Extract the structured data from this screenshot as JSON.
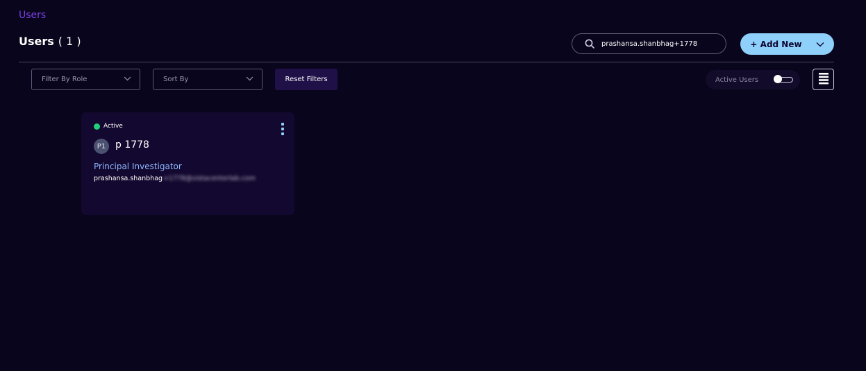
{
  "breadcrumb": {
    "label": "Users"
  },
  "header": {
    "title": "Users",
    "count": "( 1 )"
  },
  "search": {
    "value": "prashansa.shanbhag+1778",
    "icon": "search-icon"
  },
  "add_new": {
    "label": "+ Add New",
    "icon": "chevron-down-icon"
  },
  "filters": {
    "role_placeholder": "Filter By Role",
    "sort_placeholder": "Sort By",
    "reset_label": "Reset Filters",
    "active_users_label": "Active Users",
    "active_users_on": false
  },
  "users": [
    {
      "status": "Active",
      "initials": "P1",
      "name": "p 1778",
      "role": "Principal Investigator",
      "email_visible": "prashansa.shanbhag",
      "email_redacted": "+1778@vistacenterlab.com"
    }
  ],
  "colors": {
    "background": "#09051c",
    "accent": "#8fd0fb",
    "breadcrumb": "#7b3fe4",
    "active_status": "#21d07a",
    "card": "#13082f"
  }
}
